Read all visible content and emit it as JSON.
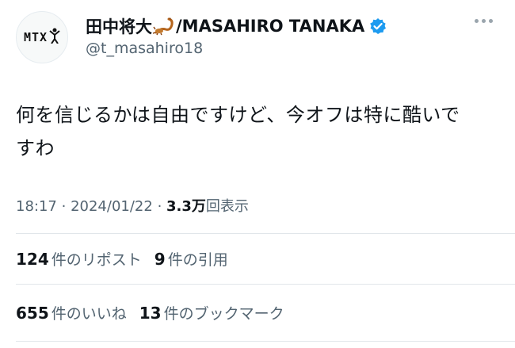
{
  "author": {
    "avatar_text": "MTX",
    "display_name": "田中将大",
    "display_name_suffix": "/MASAHIRO TANAKA",
    "handle": "@t_masahiro18",
    "emoji_icon": "scorpion-icon",
    "verified_icon": "verified-badge-icon"
  },
  "tweet": {
    "line1": "何を信じるかは自由ですけど、今オフは特に酷いで",
    "line2": "すわ"
  },
  "meta": {
    "time": "18:17",
    "separator": "·",
    "date": "2024/01/22",
    "views_count": "3.3万",
    "views_label": "回表示"
  },
  "stats": {
    "reposts_count": "124",
    "reposts_label": "件のリポスト",
    "quotes_count": "9",
    "quotes_label": "件の引用",
    "likes_count": "655",
    "likes_label": "件のいいね",
    "bookmarks_count": "13",
    "bookmarks_label": "件のブックマーク"
  },
  "colors": {
    "verified": "#1d9bf0",
    "secondary_text": "#536471",
    "primary_text": "#0f1419",
    "divider": "#e1e6ea"
  }
}
